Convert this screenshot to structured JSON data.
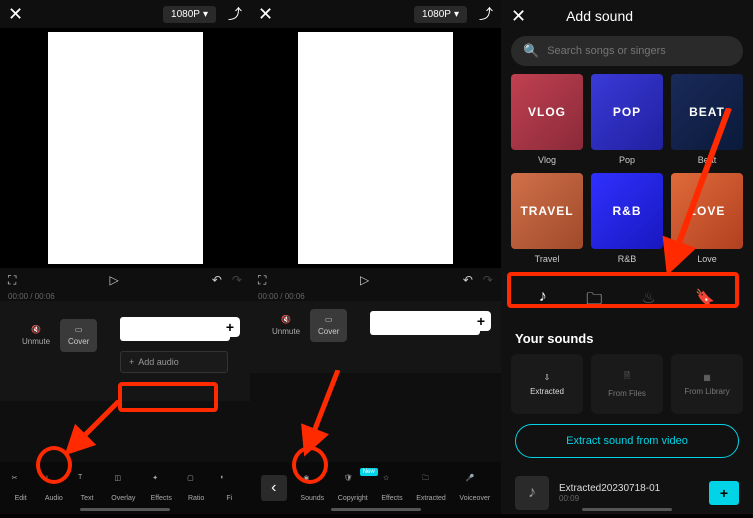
{
  "common": {
    "resolution": "1080P",
    "current_time": "00:00",
    "total_time": "00:06",
    "unmute": "Unmute",
    "cover": "Cover",
    "add_audio": "Add audio"
  },
  "panel1_toolbar": {
    "edit": "Edit",
    "audio": "Audio",
    "text": "Text",
    "overlay": "Overlay",
    "effects": "Effects",
    "ratio": "Ratio",
    "filter": "Fi"
  },
  "panel2_toolbar": {
    "sounds": "Sounds",
    "copyright": "Copyright",
    "effects": "Effects",
    "extracted": "Extracted",
    "voiceover": "Voiceover",
    "new": "New"
  },
  "panel3": {
    "title": "Add sound",
    "search_placeholder": "Search songs or singers",
    "genres_row1": [
      {
        "label": "Vlog",
        "tile": "VLOG"
      },
      {
        "label": "Pop",
        "tile": "POP"
      },
      {
        "label": "Beat",
        "tile": "BEAT"
      }
    ],
    "genres_row2": [
      {
        "label": "Travel",
        "tile": "TRAVEL"
      },
      {
        "label": "R&B",
        "tile": "R&B"
      },
      {
        "label": "Love",
        "tile": "LOVE"
      }
    ],
    "your_sounds": "Your sounds",
    "cards": {
      "extracted": "Extracted",
      "from_files": "From Files",
      "from_library": "From Library"
    },
    "extract_btn": "Extract sound from video",
    "sound_item": {
      "name": "Extracted20230718-01",
      "duration": "00:09"
    }
  }
}
